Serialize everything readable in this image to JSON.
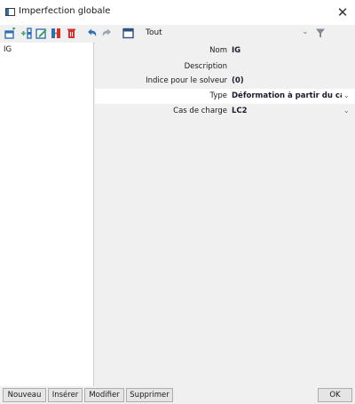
{
  "window": {
    "title": "Imperfection globale",
    "close_glyph": "✕"
  },
  "toolbar": {
    "icons": [
      "new-icon",
      "insert-icon",
      "edit-icon",
      "copy-icon",
      "delete-icon",
      "undo-icon",
      "redo-icon",
      "table-icon"
    ],
    "filter_label": "Tout",
    "chevron_glyph": "⌄"
  },
  "list": {
    "items": [
      {
        "label": "IG"
      }
    ]
  },
  "properties": [
    {
      "label": "Nom",
      "value": "IG"
    },
    {
      "label": "Description",
      "value": ""
    },
    {
      "label": "Indice pour le solveur",
      "value": "(0)"
    },
    {
      "label": "Type",
      "value": "Déformation à partir du cas de charge",
      "dropdown": true
    },
    {
      "label": "Cas de charge",
      "value": "LC2",
      "dropdown": true
    }
  ],
  "buttons": {
    "new": "Nouveau",
    "insert": "Insérer",
    "modify": "Modifier",
    "delete": "Supprimer",
    "ok": "OK"
  },
  "colors": {
    "accent_blue": "#2f6fb5",
    "delete_red": "#d9302b",
    "toolbar_green": "#3fa35a"
  }
}
